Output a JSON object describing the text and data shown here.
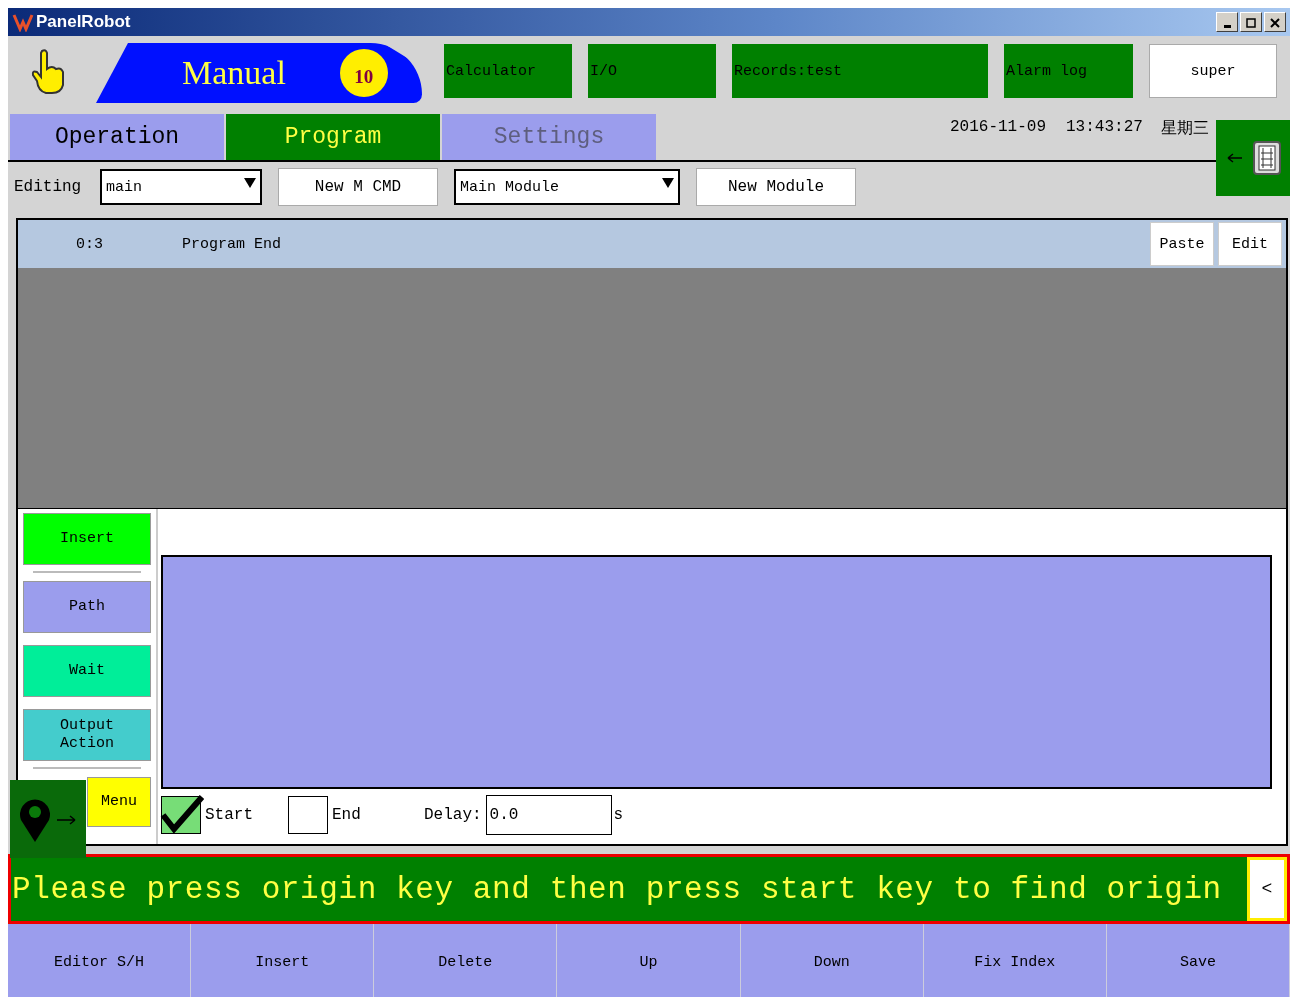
{
  "window": {
    "title": "PanelRobot"
  },
  "mode": {
    "label": "Manual",
    "speed": "10"
  },
  "tool_buttons": [
    "Calculator",
    "I/O",
    "Records:test",
    "Alarm log"
  ],
  "user": "super",
  "tabs": [
    {
      "label": "Operation",
      "selected": false,
      "disabled": false
    },
    {
      "label": "Program",
      "selected": true,
      "disabled": false
    },
    {
      "label": "Settings",
      "selected": false,
      "disabled": true
    }
  ],
  "datetime": {
    "date": "2016-11-09",
    "time": "13:43:27",
    "weekday": "星期三"
  },
  "editor": {
    "label": "Editing",
    "program": "main",
    "new_cmd": "New M CMD",
    "module": "Main Module",
    "new_module": "New Module"
  },
  "program_rows": [
    {
      "index": "0:3",
      "text": "Program End",
      "selected": true
    }
  ],
  "row_actions": [
    "Paste",
    "Edit"
  ],
  "commands": [
    {
      "label": "Insert",
      "color": "#00ff00"
    },
    {
      "label": "Path",
      "color": "#9b9ded"
    },
    {
      "label": "Wait",
      "color": "#00ee99"
    },
    {
      "label": "Output\nAction",
      "color": "#44cccc"
    },
    {
      "label": "Menu",
      "color": "#ffff00"
    }
  ],
  "options": [
    {
      "label": "Start",
      "checked": true
    },
    {
      "label": "End",
      "checked": false
    }
  ],
  "delay": {
    "label": "Delay:",
    "value": "0.0",
    "unit": "s"
  },
  "message": "Please press origin key and then press start key to find origin",
  "message_button": "<",
  "footer": [
    "Editor S/H",
    "Insert",
    "Delete",
    "Up",
    "Down",
    "Fix Index",
    "Save"
  ]
}
